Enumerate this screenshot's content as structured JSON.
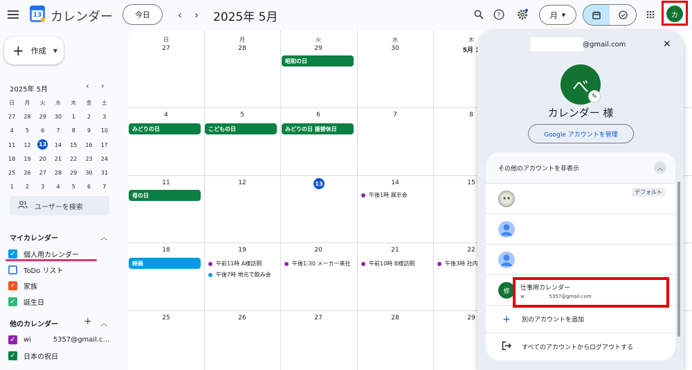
{
  "header": {
    "app_title": "カレンダー",
    "logo_day": "13",
    "today_label": "今日",
    "current_month": "2025年 5月",
    "view_label": "月",
    "account_initial": "カ"
  },
  "sidebar": {
    "create_label": "作成",
    "mini_month": "2025年 5月",
    "weekdays": [
      "日",
      "月",
      "火",
      "水",
      "木",
      "金",
      "土"
    ],
    "weeks": [
      [
        "27",
        "28",
        "29",
        "30",
        "1",
        "2",
        "3"
      ],
      [
        "4",
        "5",
        "6",
        "7",
        "8",
        "9",
        "10"
      ],
      [
        "11",
        "12",
        "13",
        "14",
        "15",
        "16",
        "17"
      ],
      [
        "18",
        "19",
        "20",
        "21",
        "22",
        "23",
        "24"
      ],
      [
        "25",
        "26",
        "27",
        "28",
        "29",
        "30",
        "31"
      ],
      [
        "1",
        "2",
        "3",
        "4",
        "5",
        "6",
        "7"
      ]
    ],
    "selected_day": "13",
    "search_people": "ユーザーを検索",
    "my_calendars_title": "マイカレンダー",
    "my_calendars": [
      {
        "label": "個人用カレンダー",
        "color": "#039be5",
        "checked": true
      },
      {
        "label": "ToDo リスト",
        "color": "#4285f4",
        "checked": false
      },
      {
        "label": "家族",
        "color": "#f4511e",
        "checked": true
      },
      {
        "label": "誕生日",
        "color": "#33b679",
        "checked": true
      }
    ],
    "other_calendars_title": "他のカレンダー",
    "other_calendars": [
      {
        "label": "wi          5357@gmail.c...",
        "color": "#8e24aa",
        "checked": true
      },
      {
        "label": "日本の祝日",
        "color": "#0b8043",
        "checked": true
      }
    ]
  },
  "grid": {
    "weekdays": [
      "日",
      "月",
      "火",
      "水",
      "木"
    ],
    "first_row_dates": [
      "27",
      "28",
      "29",
      "30",
      "5月 1"
    ],
    "rows": [
      [
        "4",
        "5",
        "6",
        "7",
        "8"
      ],
      [
        "11",
        "12",
        "13",
        "14",
        "15"
      ],
      [
        "18",
        "19",
        "20",
        "21",
        "22"
      ],
      [
        "25",
        "26",
        "27",
        "28",
        "29"
      ]
    ],
    "events": {
      "showa": "昭和の日",
      "midori": "みどりの日",
      "kodomo": "こどもの日",
      "midori_sub": "みどりの日 振替休日",
      "haha": "母の日",
      "eiga": "映画",
      "e14": "午後1時 展示会",
      "e19a": "午前11時 A様訪問",
      "e19b": "午後7時 地元で飲み会",
      "e20": "午後1:30 メーカー来社",
      "e21": "午前10時 B様訪問",
      "e22": "午後3時 社内"
    }
  },
  "account_panel": {
    "email": "@gmail.com",
    "avatar_char": "べ",
    "greeting": "カレンダー 様",
    "manage_label": "Google アカウントを管理",
    "hide_label": "その他のアカウントを非表示",
    "default_badge": "デフォルト",
    "work_avatar": "修",
    "work_name": "仕事用カレンダー",
    "work_email": "w                5357@gmail.com",
    "add_account": "別のアカウントを追加",
    "logout": "すべてのアカウントからログアウトする"
  }
}
